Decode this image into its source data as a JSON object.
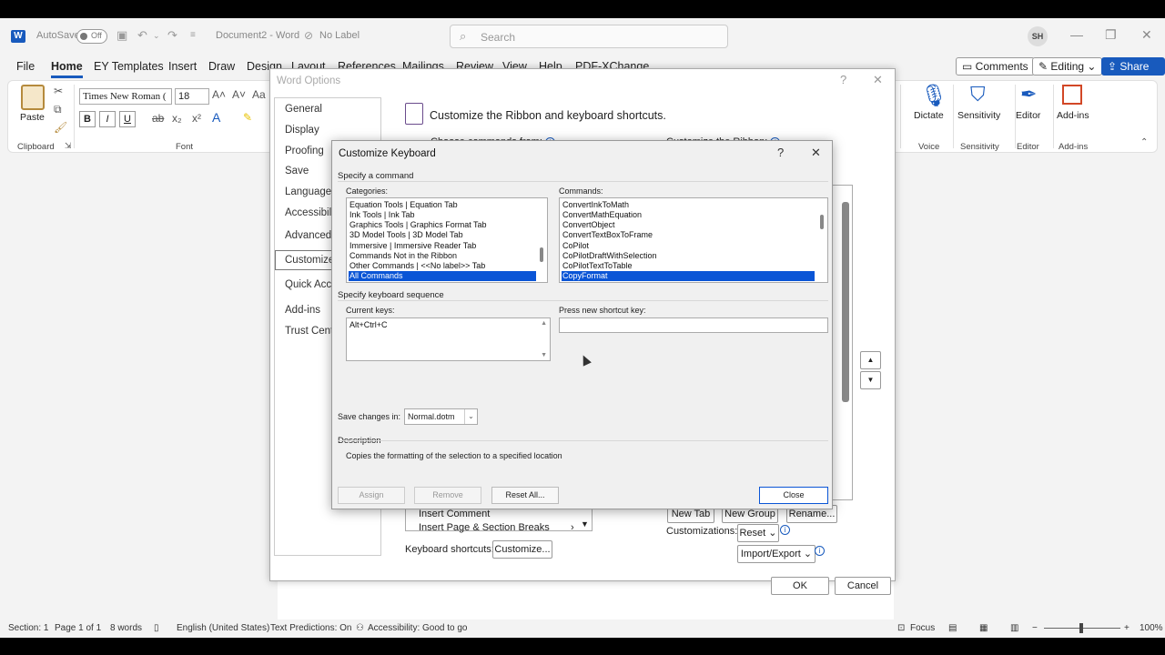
{
  "titlebar": {
    "autosave": "AutoSave",
    "toggle_state": "Off",
    "doc_title": "Document2 - Word",
    "label_status": "No Label",
    "search_placeholder": "Search",
    "user_initials": "SH"
  },
  "menu": {
    "tabs": [
      "File",
      "Home",
      "EY Templates",
      "Insert",
      "Draw",
      "Design",
      "Layout",
      "References",
      "Mailings",
      "Review",
      "View",
      "Help",
      "PDF-XChange"
    ],
    "comments": "Comments",
    "editing": "Editing",
    "share": "Share"
  },
  "ribbon": {
    "paste": "Paste",
    "clipboard": "Clipboard",
    "font_name": "Times New Roman (",
    "font_size": "18",
    "font_group": "Font",
    "bold": "B",
    "italic": "I",
    "underline": "U",
    "dictate": "Dictate",
    "voice": "Voice",
    "sensitivity": "Sensitivity",
    "sensitivity_group": "Sensitivity",
    "editor": "Editor",
    "editor_group": "Editor",
    "addins": "Add-ins",
    "addins_group": "Add-ins"
  },
  "word_options": {
    "title": "Word Options",
    "nav": [
      "General",
      "Display",
      "Proofing",
      "Save",
      "Language",
      "Accessibility",
      "Advanced",
      "Customize R",
      "Quick Acces",
      "Add-ins",
      "Trust Center"
    ],
    "heading": "Customize the Ribbon and keyboard shortcuts.",
    "choose_commands": "Choose commands from:",
    "customize_ribbon": "Customize the Ribbon:",
    "list_frag_1": "Insert Comment",
    "list_frag_2": "Insert Page & Section Breaks",
    "keyboard_shortcuts": "Keyboard shortcuts:",
    "customize_btn": "Customize...",
    "new_tab": "New Tab",
    "new_group": "New Group",
    "rename": "Rename...",
    "customizations": "Customizations:",
    "reset": "Reset",
    "import_export": "Import/Export",
    "ok": "OK",
    "cancel": "Cancel"
  },
  "customize_keyboard": {
    "title": "Customize Keyboard",
    "specify_command": "Specify a command",
    "categories_label": "Categories:",
    "categories": [
      "Equation Tools | Equation Tab",
      "Ink Tools | Ink Tab",
      "Graphics Tools | Graphics Format Tab",
      "3D Model Tools | 3D Model Tab",
      "Immersive | Immersive Reader Tab",
      "Commands Not in the Ribbon",
      "Other Commands | <<No label>> Tab",
      "All Commands"
    ],
    "commands_label": "Commands:",
    "commands": [
      "ConvertInkToMath",
      "ConvertMathEquation",
      "ConvertObject",
      "ConvertTextBoxToFrame",
      "CoPilot",
      "CoPilotDraftWithSelection",
      "CoPilotTextToTable",
      "CopyFormat"
    ],
    "specify_sequence": "Specify keyboard sequence",
    "current_keys_label": "Current keys:",
    "current_keys": "Alt+Ctrl+C",
    "new_shortcut_label": "Press new shortcut key:",
    "save_changes_label": "Save changes in:",
    "save_changes_value": "Normal.dotm",
    "description_label": "Description",
    "description": "Copies the formatting of the selection to a specified location",
    "assign": "Assign",
    "remove": "Remove",
    "reset_all": "Reset All...",
    "close": "Close"
  },
  "statusbar": {
    "section": "Section: 1",
    "page": "Page 1 of 1",
    "words": "8 words",
    "language": "English (United States)",
    "predictions": "Text Predictions: On",
    "accessibility": "Accessibility: Good to go",
    "focus": "Focus",
    "zoom": "100%"
  },
  "colors": {
    "accent": "#185abd",
    "selection": "#0a55d6"
  }
}
